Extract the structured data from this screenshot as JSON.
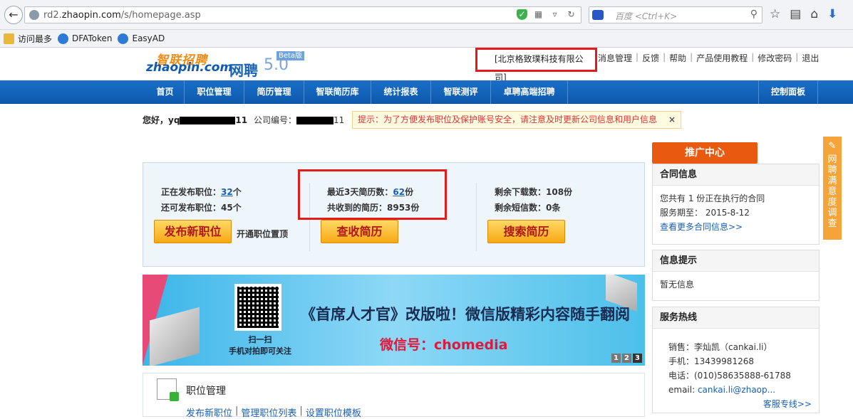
{
  "browser": {
    "url_prefix": "rd2.",
    "url_domain": "zhaopin.com",
    "url_path": "/s/homepage.asp",
    "search_placeholder": "百度 <Ctrl+K>",
    "bookmarks": [
      "访问最多",
      "DFAToken",
      "EasyAD"
    ]
  },
  "header": {
    "logo_cn": "智联招聘",
    "logo_en": "zhaopin.com",
    "product": "网聘",
    "version": "5.0",
    "beta": "Beta版",
    "company": "[北京格致璞科技有限公司]",
    "links": [
      "消息管理",
      "反馈",
      "帮助",
      "产品使用教程",
      "修改密码",
      "退出"
    ]
  },
  "nav": {
    "items": [
      "首页",
      "职位管理",
      "简历管理",
      "智联简历库",
      "统计报表",
      "智联测评",
      "卓聘高端招聘"
    ],
    "control": "控制面板"
  },
  "greeting": {
    "hello": "您好，yq",
    "tail": "11",
    "company_no_label": "公司编号：",
    "company_no_tail": "11"
  },
  "tip": {
    "text": "提示：为了方便发布职位及保护账号安全，请注意及时更新公司信息和用户信息",
    "close": "×"
  },
  "stats": {
    "publishing_label": "正在发布职位：",
    "publishing_value": "32",
    "publishing_unit": "个",
    "available_label": "还可发布职位：45个",
    "recent_label": "最近3天简历数：",
    "recent_value": "62",
    "recent_unit": "份",
    "total_label": "共收到的简历：8953份",
    "downloads": "剩余下载数：108份",
    "sms": "剩余短信数：0条",
    "btn_publish": "发布新职位",
    "link_top": "开通职位置顶",
    "btn_inbox": "查收简历",
    "btn_search": "搜索简历"
  },
  "banner": {
    "qr_caption_1": "扫一扫",
    "qr_caption_2": "手机对拍即可关注",
    "title": "《首席人才官》改版啦！微信版精彩内容随手翻阅",
    "sub": "微信号：chomedia",
    "pages": [
      "1",
      "2",
      "3"
    ]
  },
  "jobs": {
    "title": "职位管理",
    "links": [
      "发布新职位",
      "管理职位列表",
      "设置职位模板"
    ]
  },
  "sidebar": {
    "promo": "推广中心",
    "contract_title": "合同信息",
    "contract_line1": "您共有 1 份正在执行的合同",
    "contract_line2": "服务期至：  2015-8-12",
    "contract_more": "查看更多合同信息>>",
    "notice_title": "信息提示",
    "notice_body": "暂无信息",
    "hotline_title": "服务热线",
    "hotline_name": "销售：李灿凯（cankai.li）",
    "hotline_mobile": "手机：13439981268",
    "hotline_phone": "电话：(010)58635888-61788",
    "hotline_email_label": "email: ",
    "hotline_email": "cankai.li@zhaop...",
    "hotline_more": "客服专线>>",
    "survey": "网聘满意度调查"
  }
}
